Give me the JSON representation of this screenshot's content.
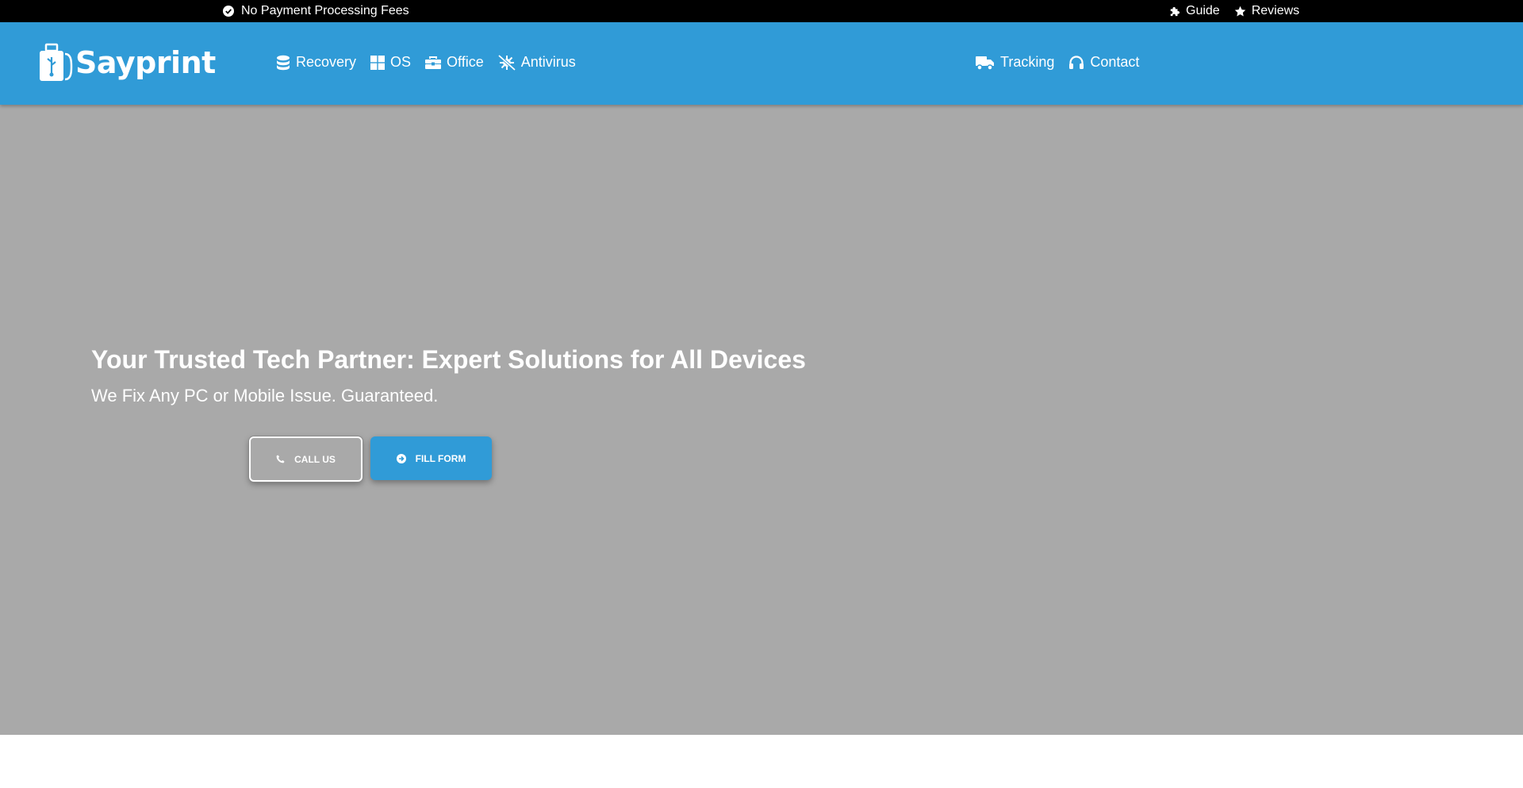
{
  "topbar": {
    "notice": "No Payment Processing Fees",
    "links": [
      {
        "label": "Guide",
        "icon": "puzzle-icon"
      },
      {
        "label": "Reviews",
        "icon": "star-icon"
      }
    ]
  },
  "header": {
    "brand": "Sayprint",
    "nav_left": [
      {
        "label": "Recovery",
        "icon": "database-icon"
      },
      {
        "label": "OS",
        "icon": "windows-icon"
      },
      {
        "label": "Office",
        "icon": "toolbox-icon"
      },
      {
        "label": "Antivirus",
        "icon": "virus-slash-icon"
      }
    ],
    "nav_right": [
      {
        "label": "Tracking",
        "icon": "truck-icon"
      },
      {
        "label": "Contact",
        "icon": "headset-icon"
      }
    ]
  },
  "hero": {
    "title": "Your Trusted Tech Partner: Expert Solutions for All Devices",
    "subtitle": "We Fix Any PC or Mobile Issue. Guaranteed.",
    "call_label": "CALL US",
    "form_label": "FILL FORM"
  },
  "colors": {
    "brand": "#309bd7",
    "topbar": "#000000",
    "hero_bg": "#a9a9a9"
  }
}
